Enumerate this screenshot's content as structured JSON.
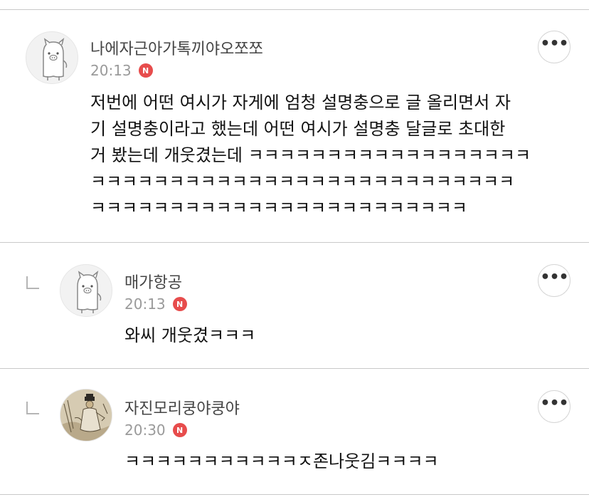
{
  "comments": [
    {
      "author": "나에자근아가톡끼야오쪼쪼",
      "time": "20:13",
      "badge": "N",
      "text": "저번에 어떤 여시가 자게에 엄청 설명충으로 글 올리면서 자\n기 설명충이라고 했는데 어떤 여시가 설명충 달글로 초대한\n거 봤는데 개웃겼는데 ㅋㅋㅋㅋㅋㅋㅋㅋㅋㅋㅋㅋㅋㅋㅋㅋㅋㅋ\nㅋㅋㅋㅋㅋㅋㅋㅋㅋㅋㅋㅋㅋㅋㅋㅋㅋㅋㅋㅋㅋㅋㅋㅋㅋㅋㅋ\nㅋㅋㅋㅋㅋㅋㅋㅋㅋㅋㅋㅋㅋㅋㅋㅋㅋㅋㅋㅋㅋㅋㅋㅋ",
      "avatar_icon": "pig-ghost-avatar",
      "is_reply": false
    },
    {
      "author": "매가항공",
      "time": "20:13",
      "badge": "N",
      "text": "와씨 개웃겼ㅋㅋㅋ",
      "avatar_icon": "pig-ghost-avatar",
      "is_reply": true
    },
    {
      "author": "자진모리쿵야쿵야",
      "time": "20:30",
      "badge": "N",
      "text": "ㅋㅋㅋㅋㅋㅋㅋㅋㅋㅋㅋㅈ존나웃김ㅋㅋㅋㅋ",
      "avatar_icon": "painting-avatar",
      "is_reply": true
    }
  ],
  "more_label": "•••",
  "colors": {
    "badge": "#e74c4c",
    "divider": "#c9c9c9",
    "meta": "#9a9a9a"
  }
}
